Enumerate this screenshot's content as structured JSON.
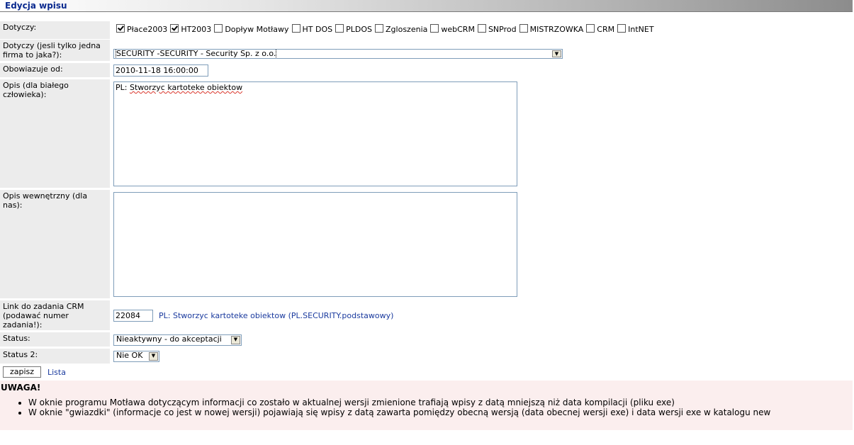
{
  "title": "Edycja wpisu",
  "labels": {
    "dotyczy": "Dotyczy:",
    "firma": "Dotyczy (jesli tylko jedna firma to jaka?):",
    "obowiazuje": "Obowiazuje od:",
    "opis": "Opis (dla białego człowieka):",
    "opis_wew": "Opis wewnętrzny (dla nas):",
    "link_crm": "Link do zadania CRM (podawać numer zadania!):",
    "status": "Status:",
    "status2": "Status 2:"
  },
  "checkboxes": [
    {
      "label": "Płace2003",
      "checked": true
    },
    {
      "label": "HT2003",
      "checked": true
    },
    {
      "label": "Dopływ Motławy",
      "checked": false
    },
    {
      "label": "HT DOS",
      "checked": false
    },
    {
      "label": "PLDOS",
      "checked": false
    },
    {
      "label": "Zgloszenia",
      "checked": false
    },
    {
      "label": "webCRM",
      "checked": false
    },
    {
      "label": "SNProd",
      "checked": false
    },
    {
      "label": "MISTRZOWKA",
      "checked": false
    },
    {
      "label": "CRM",
      "checked": false
    },
    {
      "label": "IntNET",
      "checked": false
    }
  ],
  "firma_select": "SECURITY -SECURITY - Security Sp. z o.o.",
  "obowiazuje_value": "2010-11-18 16:00:00",
  "opis": {
    "prefix": "PL: ",
    "text": "Stworzyc kartoteke obiektow"
  },
  "opis_wew": "",
  "crm": {
    "number": "22084",
    "link": "PL: Stworzyc kartoteke obiektow (PL.SECURITY.podstawowy)"
  },
  "status_select": "Nieaktywny - do akceptacji",
  "status2_select": "Nie OK",
  "actions": {
    "save": "zapisz",
    "list": "Lista"
  },
  "warning": {
    "title": "UWAGA!",
    "items": [
      "W oknie programu Motława dotyczącym informacji co zostało w aktualnej wersji zmienione trafiają wpisy z datą mniejszą niż data kompilacji (pliku exe)",
      "W oknie \"gwiazdki\" (informacje co jest w nowej wersji) pojawiają się wpisy z datą zawarta pomiędzy obecną wersją (data obecnej wersji exe) i data wersji exe w katalogu new"
    ]
  }
}
